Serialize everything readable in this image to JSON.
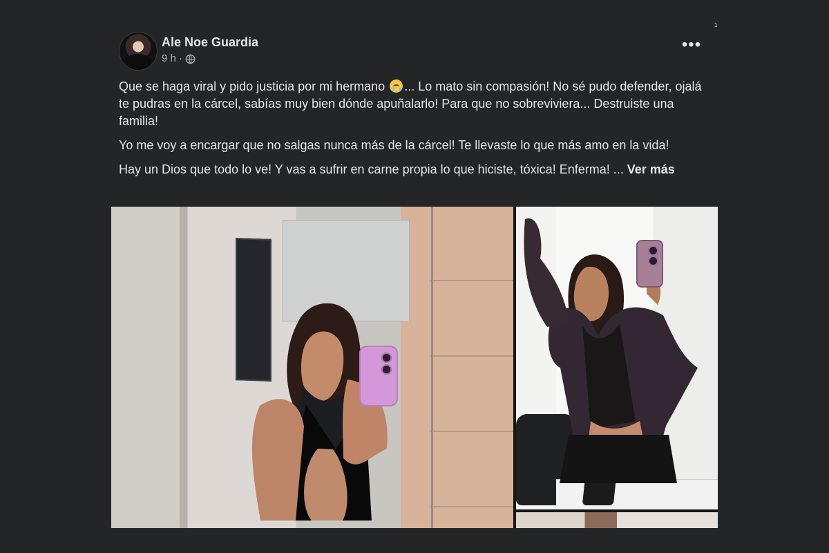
{
  "post": {
    "author": "Ale Noe Guardia",
    "time": "9 h",
    "separator": "·",
    "privacy_icon": "public-globe-icon",
    "more_icon": "more-options-icon",
    "more_label": "•••",
    "corner_mark": "1",
    "text": {
      "line1_start": "Que se haga viral y pido justicia por mi hermano ",
      "line1_end": "... Lo mato sin compasión! No sé pudo defender, ojalá te pudras en la cárcel, sabías muy bien dónde apuñalarlo! Para que no sobreviviera... Destruiste una familia!",
      "line2": "Yo me voy a encargar que no salgas nunca más de la cárcel! Te llevaste lo que más amo en la vida!",
      "line3": "Hay un Dios que todo lo ve! Y vas a sufrir en carne propia lo que hiciste, tóxica! Enferma! ... ",
      "see_more": "Ver más"
    }
  },
  "media": {
    "main_photo_label": "",
    "side_photo_label": "",
    "bottom_photo_label": ""
  },
  "colors": {
    "background": "#242526",
    "text_primary": "#e4e6eb",
    "text_secondary": "#b0b3b8"
  }
}
